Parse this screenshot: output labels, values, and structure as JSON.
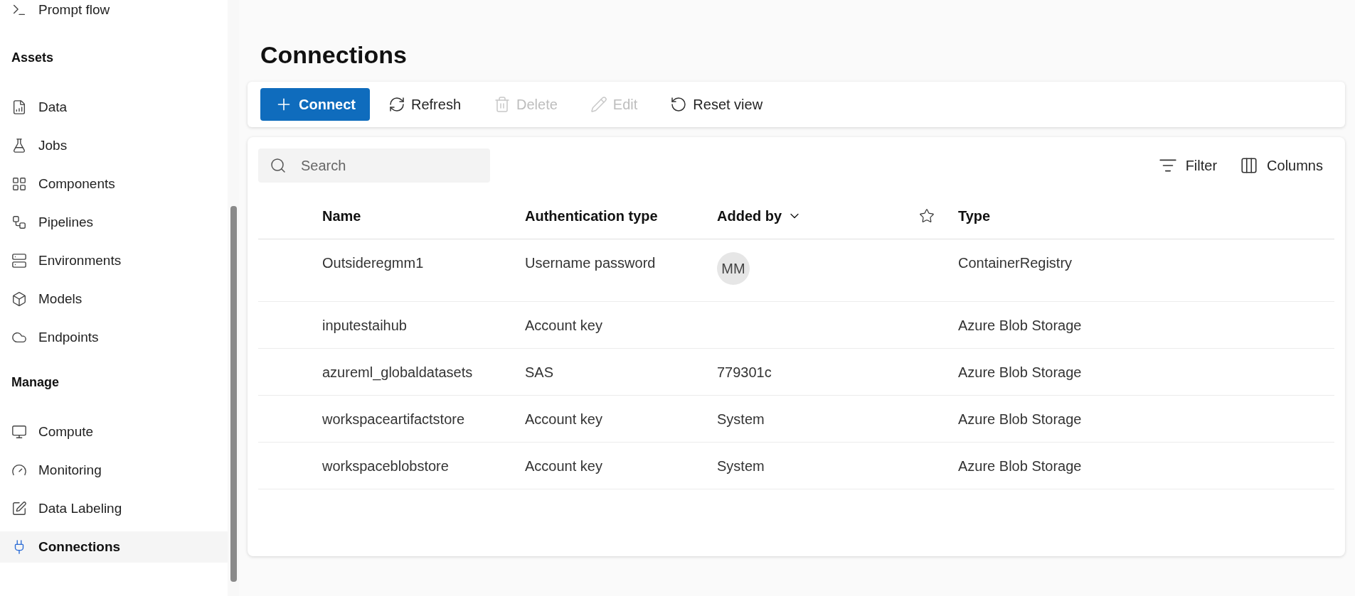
{
  "sidebar": {
    "top_item": {
      "label": "Prompt flow"
    },
    "sections": [
      {
        "heading": "Assets",
        "items": [
          {
            "label": "Data",
            "selected": false
          },
          {
            "label": "Jobs",
            "selected": false
          },
          {
            "label": "Components",
            "selected": false
          },
          {
            "label": "Pipelines",
            "selected": false
          },
          {
            "label": "Environments",
            "selected": false
          },
          {
            "label": "Models",
            "selected": false
          },
          {
            "label": "Endpoints",
            "selected": false
          }
        ]
      },
      {
        "heading": "Manage",
        "items": [
          {
            "label": "Compute",
            "selected": false
          },
          {
            "label": "Monitoring",
            "selected": false
          },
          {
            "label": "Data Labeling",
            "selected": false
          },
          {
            "label": "Connections",
            "selected": true
          }
        ]
      }
    ]
  },
  "page": {
    "title": "Connections"
  },
  "toolbar": [
    {
      "label": "Connect",
      "kind": "primary",
      "disabled": false
    },
    {
      "label": "Refresh",
      "kind": "plain",
      "disabled": false
    },
    {
      "label": "Delete",
      "kind": "plain",
      "disabled": true
    },
    {
      "label": "Edit",
      "kind": "plain",
      "disabled": true
    },
    {
      "label": "Reset view",
      "kind": "plain",
      "disabled": false
    }
  ],
  "search": {
    "placeholder": "Search"
  },
  "table_actions": [
    {
      "label": "Filter"
    },
    {
      "label": "Columns"
    }
  ],
  "table": {
    "columns": [
      {
        "label": "Name",
        "sortable": false
      },
      {
        "label": "Authentication type",
        "sortable": false
      },
      {
        "label": "Added by",
        "sortable": true
      },
      {
        "label": "Type",
        "sortable": false
      }
    ],
    "rows": [
      {
        "name": "Outsideregmm1",
        "auth": "Username password",
        "added_by": {
          "initials": "MM"
        },
        "type": "ContainerRegistry"
      },
      {
        "name": "inputestaihub",
        "auth": "Account key",
        "added_by": {},
        "type": "Azure Blob Storage"
      },
      {
        "name": "azureml_globaldatasets",
        "auth": "SAS",
        "added_by": {
          "text": "779301c"
        },
        "type": "Azure Blob Storage"
      },
      {
        "name": "workspaceartifactstore",
        "auth": "Account key",
        "added_by": {
          "text": "System"
        },
        "type": "Azure Blob Storage"
      },
      {
        "name": "workspaceblobstore",
        "auth": "Account key",
        "added_by": {
          "text": "System"
        },
        "type": "Azure Blob Storage"
      }
    ]
  }
}
